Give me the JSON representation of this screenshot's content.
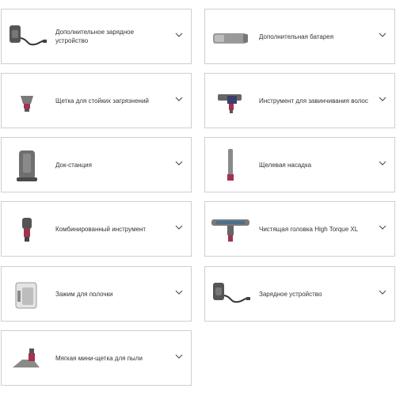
{
  "accessories": [
    {
      "label": "Дополнительное зарядное устройство",
      "icon": "charger-icon"
    },
    {
      "label": "Дополнительная батарея",
      "icon": "battery-icon"
    },
    {
      "label": "Щетка для стойких загрязнений",
      "icon": "stubborn-dirt-brush-icon"
    },
    {
      "label": "Инструмент для завинчивания волос",
      "icon": "hair-screw-tool-icon"
    },
    {
      "label": "Док-станция",
      "icon": "dock-station-icon"
    },
    {
      "label": "Щелевая насадка",
      "icon": "crevice-tool-icon"
    },
    {
      "label": "Комбинированный инструмент",
      "icon": "combination-tool-icon"
    },
    {
      "label": "Чистящая головка High Torque XL",
      "icon": "cleaner-head-icon"
    },
    {
      "label": "Зажим для полочки",
      "icon": "shelf-clip-icon"
    },
    {
      "label": "Зарядное устройство",
      "icon": "charger-icon"
    },
    {
      "label": "Мягкая мини-щетка для пыли",
      "icon": "mini-soft-dusting-brush-icon"
    }
  ],
  "colors": {
    "border": "#cfcfcf",
    "chevron": "#555555",
    "product_grey": "#8a8a8a",
    "product_red": "#a2334f"
  }
}
